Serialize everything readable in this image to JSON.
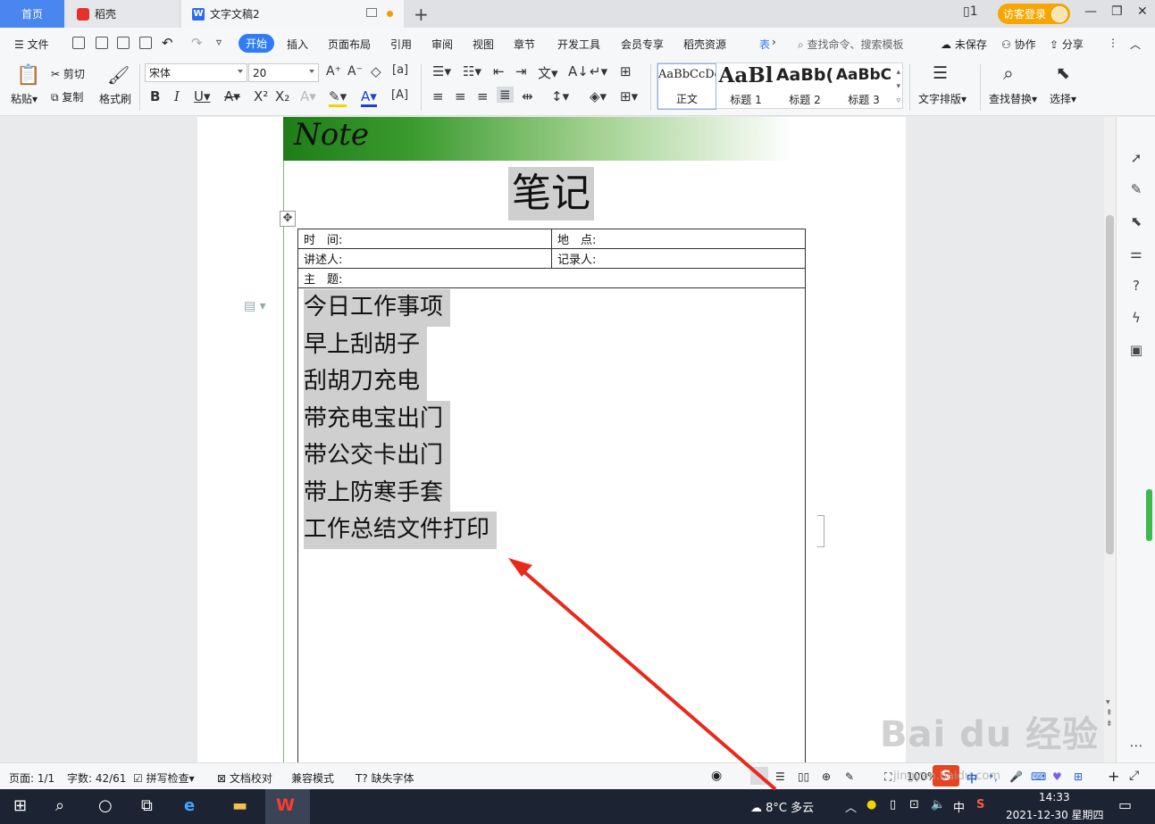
{
  "tabs": {
    "home": "首页",
    "doc1": "稻壳",
    "doc2": "文字文稿2",
    "login": "访客登录"
  },
  "menu": {
    "file": "文件",
    "items": [
      "开始",
      "插入",
      "页面布局",
      "引用",
      "审阅",
      "视图",
      "章节",
      "开发工具",
      "会员专享",
      "稻壳资源",
      "表"
    ],
    "search_placeholder": "查找命令、搜索模板",
    "unsaved": "未保存",
    "collab": "协作",
    "share": "分享"
  },
  "ribbon": {
    "paste": "粘贴",
    "cut": "剪切",
    "copy": "复制",
    "format_painter": "格式刷",
    "font_name": "宋体",
    "font_size": "20",
    "styles": [
      {
        "sample": "AaBbCcDd",
        "name": "正文"
      },
      {
        "sample": "AaBl",
        "name": "标题 1"
      },
      {
        "sample": "AaBb(",
        "name": "标题 2"
      },
      {
        "sample": "AaBbC",
        "name": "标题 3"
      }
    ],
    "text_layout": "文字排版",
    "find_replace": "查找替换",
    "select": "选择"
  },
  "document": {
    "banner": "Note",
    "title": "笔记",
    "table": {
      "time": "时　间:",
      "place": "地　点:",
      "speaker": "讲述人:",
      "recorder": "记录人:",
      "topic": "主　题:"
    },
    "lines": [
      "今日工作事项",
      "早上刮胡子",
      "刮胡刀充电",
      "带充电宝出门",
      "带公交卡出门",
      "带上防寒手套",
      "工作总结文件打印"
    ]
  },
  "status": {
    "page": "页面: 1/1",
    "words": "字数: 42/61",
    "spell": "拼写检查",
    "proof": "文档校对",
    "compat": "兼容模式",
    "missing_font": "缺失字体",
    "zoom": "100%"
  },
  "taskbar": {
    "weather": "8°C  多云",
    "ime": "中",
    "time": "14:33",
    "date": "2021-12-30 星期四"
  },
  "watermark": {
    "main": "Bai du 经验",
    "sub": "jingyan.baidu.com"
  },
  "colors": {
    "accent": "#2f7cf6",
    "login": "#f7a600",
    "banner_green": "#1f7d18",
    "highlight": "#cfcfcf",
    "arrow": "#e8291c"
  }
}
